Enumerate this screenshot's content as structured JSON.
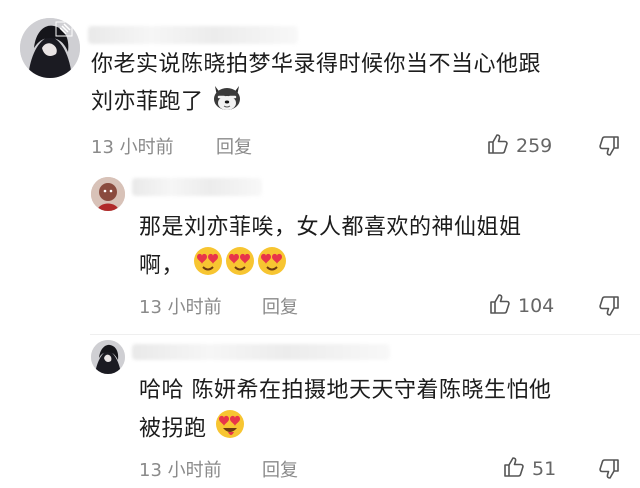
{
  "comments": [
    {
      "text_line1": "你老实说陈晓拍梦华录得时候你当不当心他跟",
      "text_line2": "刘亦菲跑了",
      "emoji": "dog-emoji",
      "time": "13 小时前",
      "reply_label": "回复",
      "likes": "259"
    },
    {
      "text_line1": "那是刘亦菲唉，女人都喜欢的神仙姐姐",
      "text_line2": "啊，",
      "emoji": "heart-eyes-emoji",
      "time": "13 小时前",
      "reply_label": "回复",
      "likes": "104"
    },
    {
      "text_line1": "哈哈 陈妍希在拍摄地天天守着陈晓生怕他",
      "text_line2": "被拐跑",
      "emoji": "heart-eyes-tongue-emoji",
      "time": "13 小时前",
      "reply_label": "回复",
      "likes": "51"
    }
  ],
  "icons": {
    "like": "thumbs-up-icon",
    "dislike": "thumbs-down-icon"
  },
  "colors": {
    "meta_text": "#8a8a8a",
    "body_text": "#1c1c1c",
    "emoji_face": "#f7c531",
    "heart": "#e8344a"
  }
}
